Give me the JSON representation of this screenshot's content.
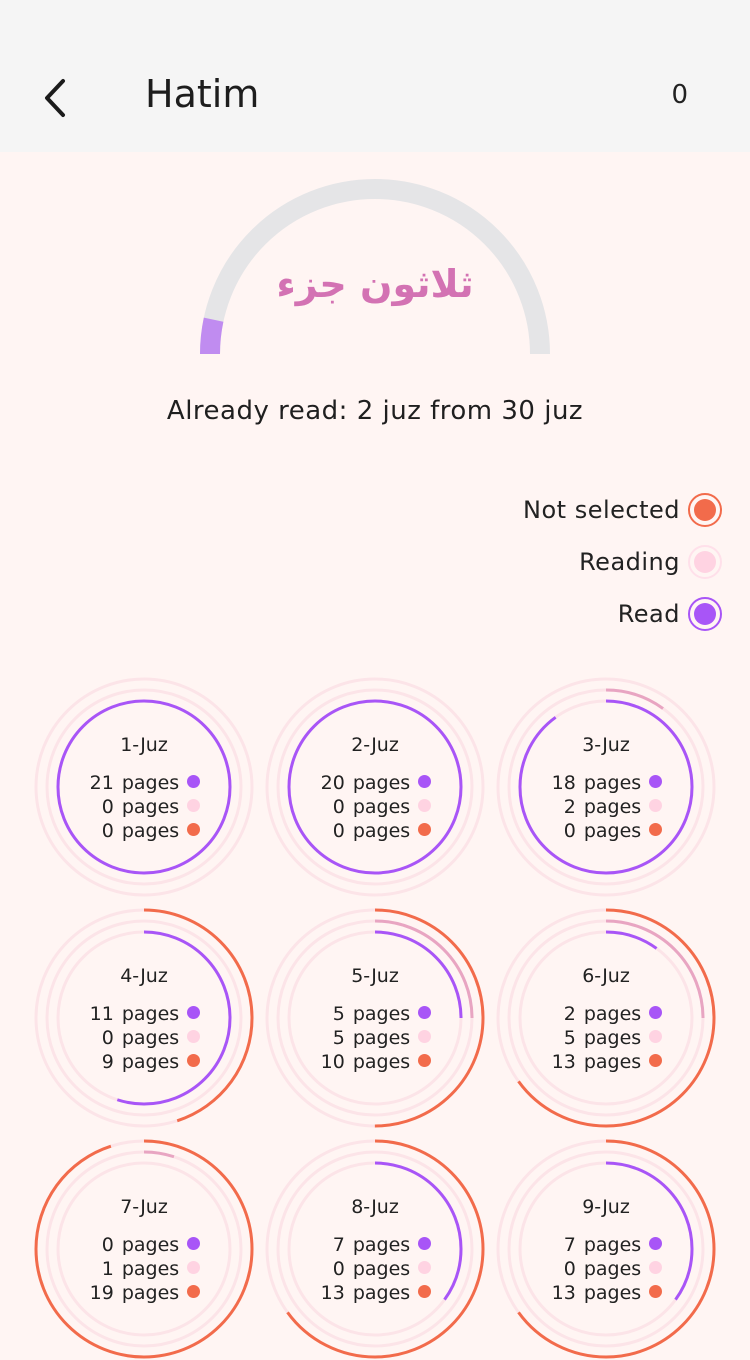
{
  "header": {
    "title": "Hatim",
    "count": "0"
  },
  "progress": {
    "arabic_title": "ثلاثون جزء",
    "already_read_text": "Already read: 2 juz from 30 juz",
    "read_fraction": 0.0667
  },
  "legend": [
    {
      "label": "Not selected",
      "color": "#F26B4B"
    },
    {
      "label": "Reading",
      "color": "#FFD3E2"
    },
    {
      "label": "Read",
      "color": "#A855F7"
    }
  ],
  "colors": {
    "read": "#A855F7",
    "reading": "#E8A5C2",
    "not_selected": "#F26B4B",
    "track": "#FCE4E8",
    "gauge_track": "#E5E5E7",
    "gauge_fill": "#C08CF0"
  },
  "page_unit": "pages",
  "juz": [
    {
      "title": "1-Juz",
      "read": "21",
      "reading": "0",
      "not_selected": "0"
    },
    {
      "title": "2-Juz",
      "read": "20",
      "reading": "0",
      "not_selected": "0"
    },
    {
      "title": "3-Juz",
      "read": "18",
      "reading": "2",
      "not_selected": "0"
    },
    {
      "title": "4-Juz",
      "read": "11",
      "reading": "0",
      "not_selected": "9"
    },
    {
      "title": "5-Juz",
      "read": "5",
      "reading": "5",
      "not_selected": "10"
    },
    {
      "title": "6-Juz",
      "read": "2",
      "reading": "5",
      "not_selected": "13"
    },
    {
      "title": "7-Juz",
      "read": "0",
      "reading": "1",
      "not_selected": "19"
    },
    {
      "title": "8-Juz",
      "read": "7",
      "reading": "0",
      "not_selected": "13"
    },
    {
      "title": "9-Juz",
      "read": "7",
      "reading": "0",
      "not_selected": "13"
    }
  ]
}
